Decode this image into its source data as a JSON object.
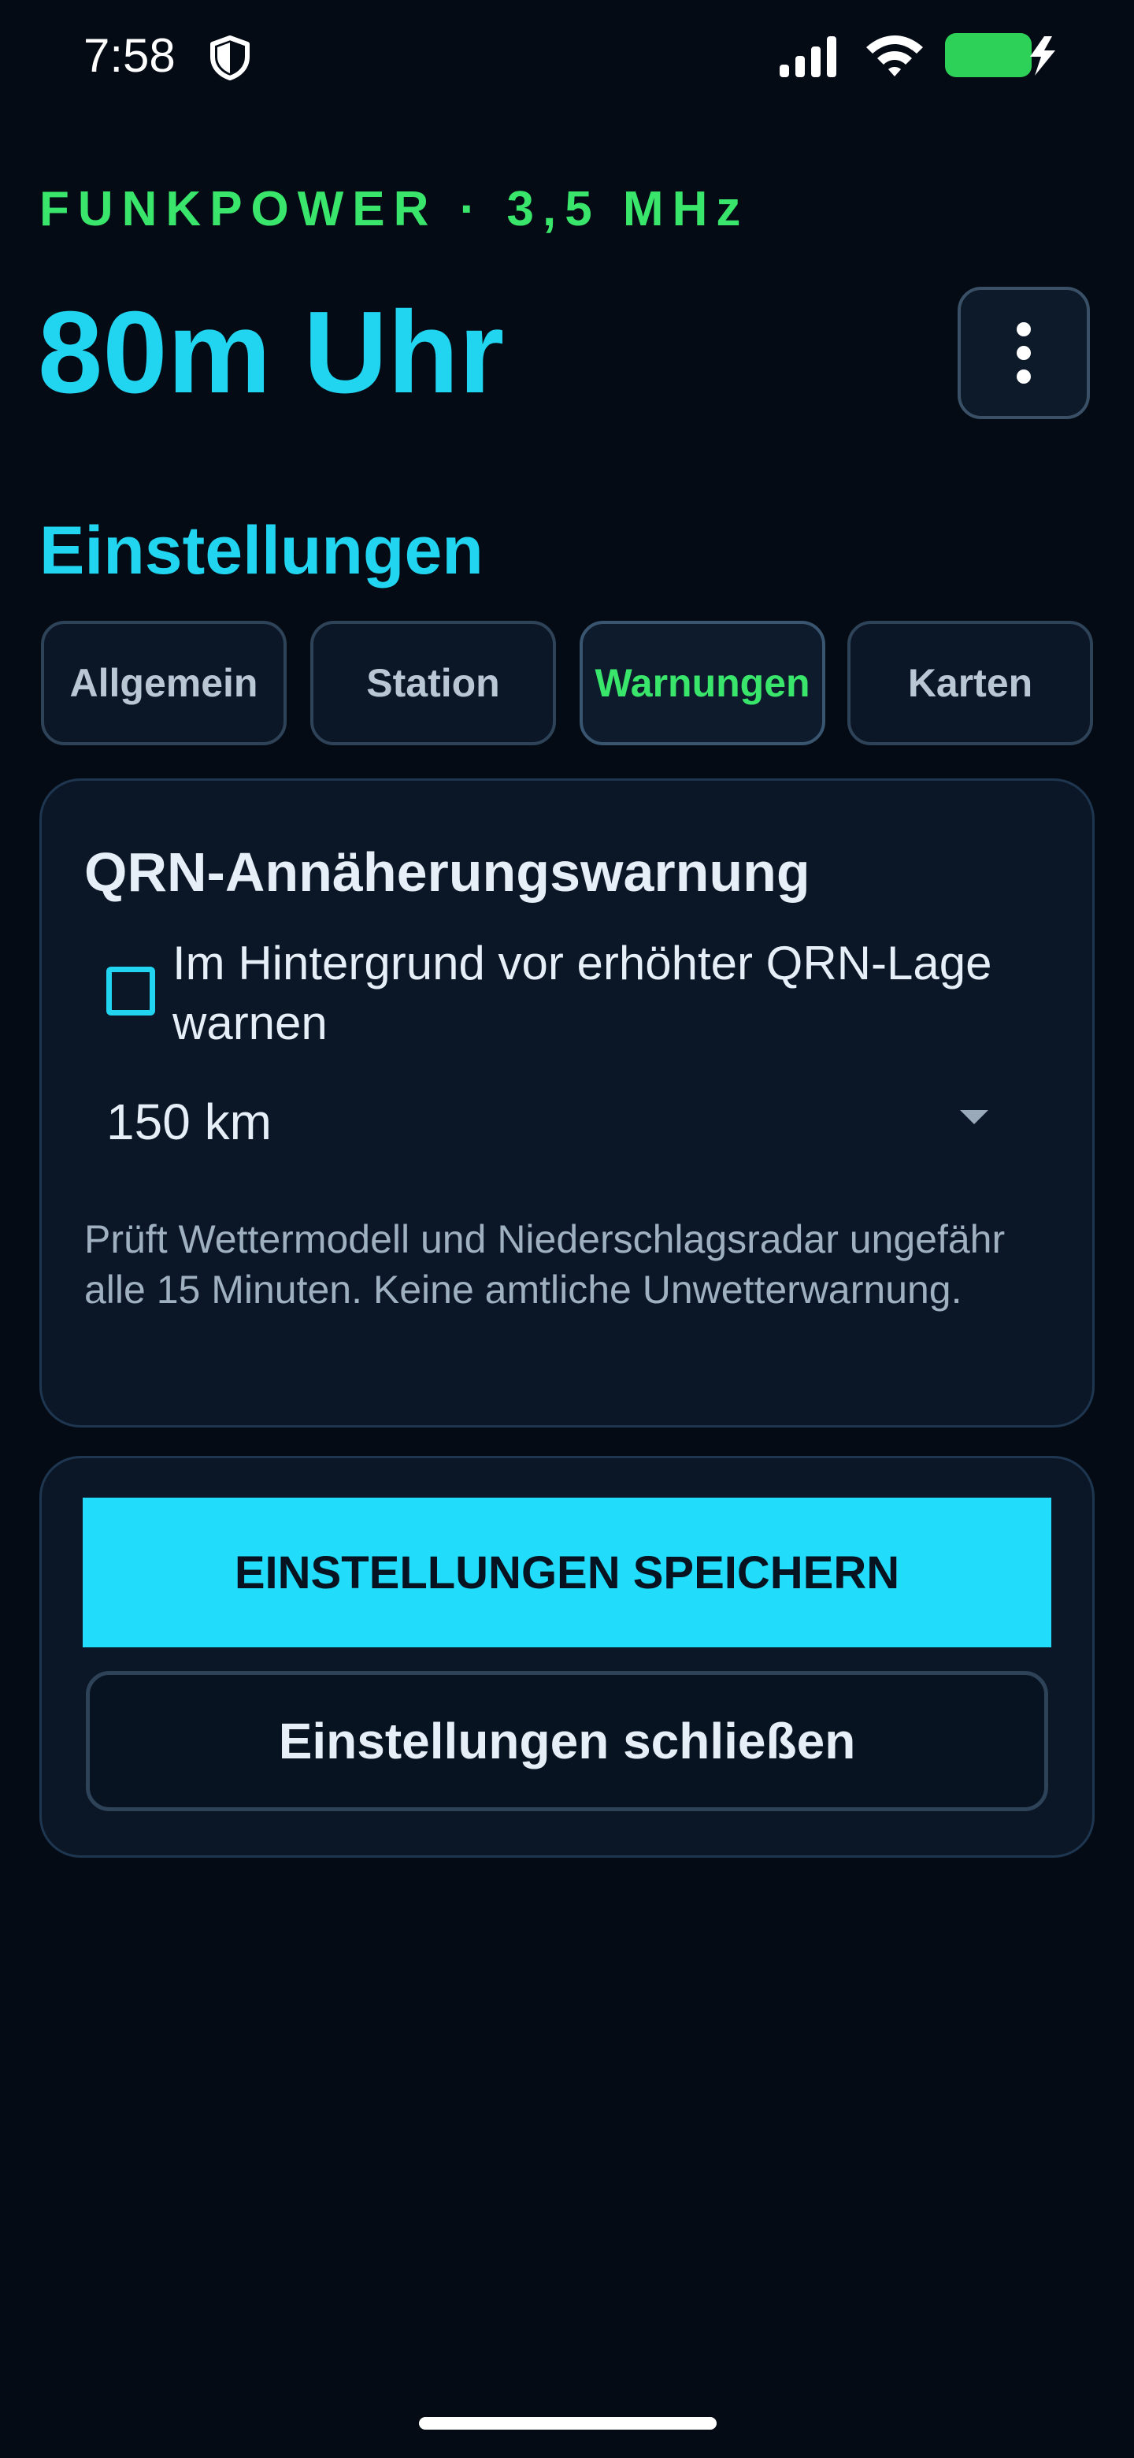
{
  "status_bar": {
    "time": "7:58",
    "icons": [
      "shield-icon",
      "signal-icon",
      "wifi-icon",
      "battery-charging-icon"
    ],
    "battery_color": "#2ed158"
  },
  "header": {
    "eyebrow": "FUNKPOWER · 3,5 MHz",
    "title": "80m Uhr",
    "menu_icon": "more-vertical-icon"
  },
  "settings": {
    "section_title": "Einstellungen",
    "tabs": [
      {
        "label": "Allgemein",
        "active": false
      },
      {
        "label": "Station",
        "active": false
      },
      {
        "label": "Warnungen",
        "active": true
      },
      {
        "label": "Karten",
        "active": false
      }
    ]
  },
  "warning_card": {
    "heading": "QRN-Annäherungswarnung",
    "checkbox_label": "Im Hintergrund vor erhöhter QRN-Lage warnen",
    "checkbox_checked": false,
    "distance_value": "150 km",
    "help_text": "Prüft Wettermodell und Niederschlagsradar ungefähr alle 15 Minuten. Keine amtliche Unwetterwarnung."
  },
  "actions": {
    "save_label": "EINSTELLUNGEN SPEICHERN",
    "close_label": "Einstellungen schließen"
  },
  "colors": {
    "background": "#040b14",
    "accent_cyan": "#21d4f0",
    "accent_green": "#39e66b",
    "card": "#0b1727"
  }
}
